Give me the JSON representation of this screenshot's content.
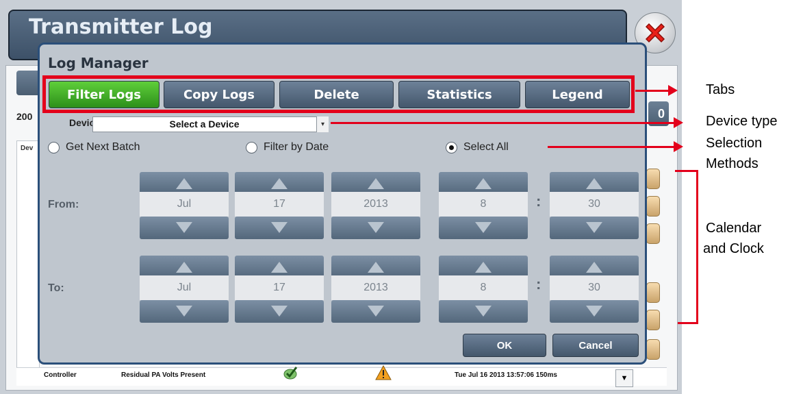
{
  "app": {
    "title": "Transmitter Log"
  },
  "background": {
    "count_left": "200",
    "count_right": "0",
    "table_header": "Dev",
    "last_row": {
      "device": "Controller",
      "event": "Residual PA Volts Present",
      "timestamp": "Tue Jul 16 2013 13:57:06 150ms",
      "sel": "▼"
    }
  },
  "modal": {
    "title": "Log Manager",
    "tabs": [
      {
        "label": "Filter Logs",
        "active": true
      },
      {
        "label": "Copy Logs",
        "active": false
      },
      {
        "label": "Delete",
        "active": false
      },
      {
        "label": "Statistics",
        "active": false
      },
      {
        "label": "Legend",
        "active": false
      }
    ],
    "device": {
      "label": "Device",
      "value": "Select a Device",
      "arrow": "▾"
    },
    "selection": [
      {
        "label": "Get Next Batch",
        "checked": false
      },
      {
        "label": "Filter by Date",
        "checked": false
      },
      {
        "label": "Select All",
        "checked": true
      }
    ],
    "from": {
      "label": "From:",
      "month": "Jul",
      "day": "17",
      "year": "2013",
      "hour": "8",
      "minute": "30"
    },
    "to": {
      "label": "To:",
      "month": "Jul",
      "day": "17",
      "year": "2013",
      "hour": "8",
      "minute": "30"
    },
    "time_separator": ":",
    "ok_label": "OK",
    "cancel_label": "Cancel"
  },
  "annotations": {
    "tabs": "Tabs",
    "device_type": "Device type",
    "selection_line1": "Selection",
    "selection_line2": "Methods",
    "calendar_line1": "Calendar",
    "calendar_line2": "and Clock"
  },
  "colors": {
    "callout": "#e3001b",
    "active_tab": "#3cae25",
    "modal_border": "#2b4f7a"
  }
}
